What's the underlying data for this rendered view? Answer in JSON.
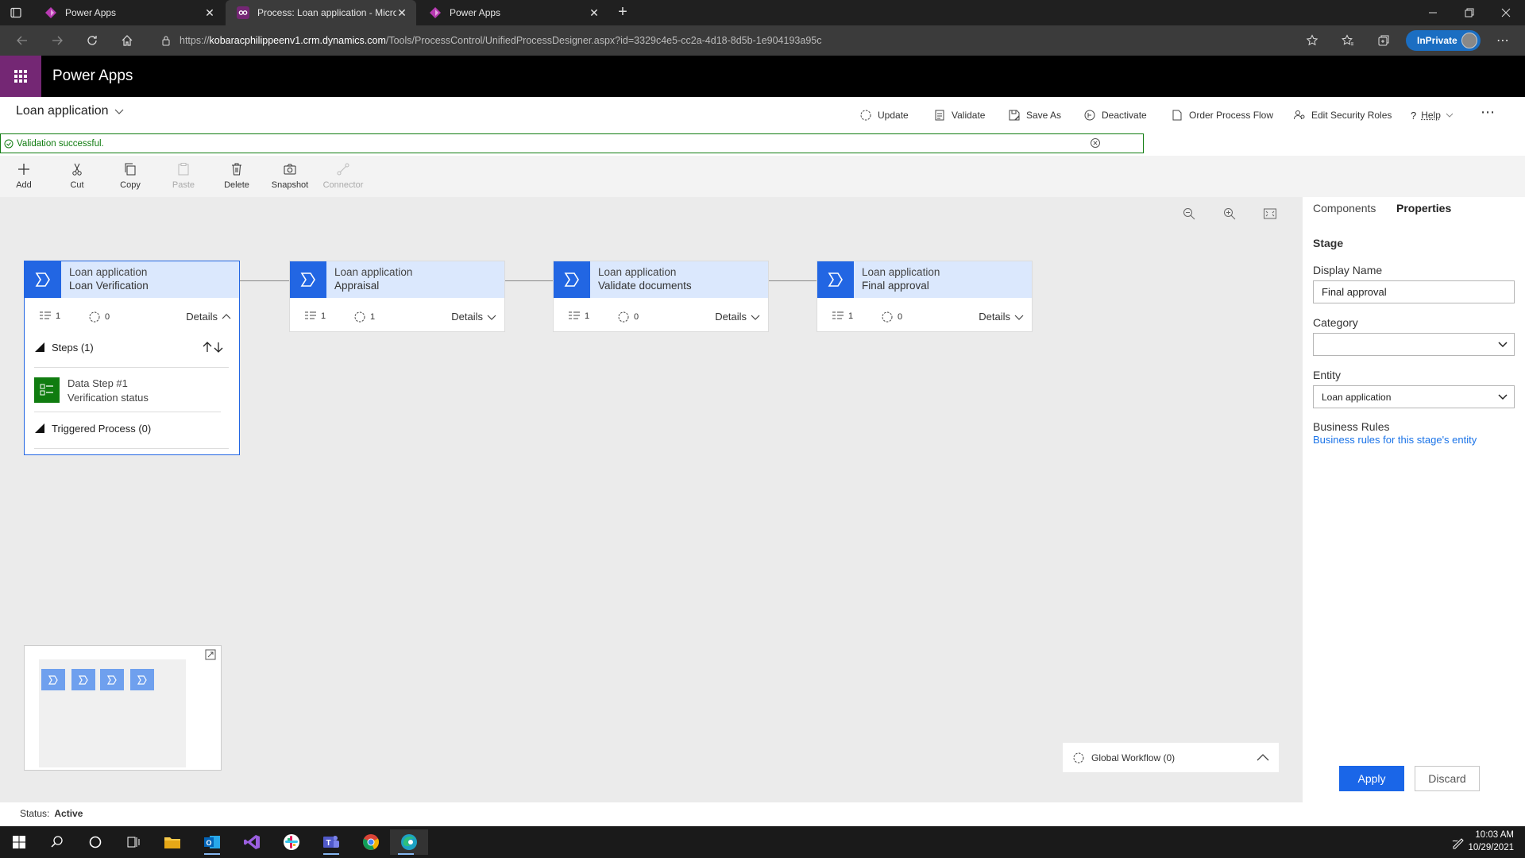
{
  "browser": {
    "tabs": [
      {
        "title": "Power Apps",
        "icon": "powerapps-icon",
        "active": false
      },
      {
        "title": "Process: Loan application - Micro",
        "icon": "dynamics-icon",
        "active": true
      },
      {
        "title": "Power Apps",
        "icon": "powerapps-icon",
        "active": false
      }
    ],
    "url_prefix": "https://",
    "url_host": "kobaracphilippeenv1.crm.dynamics.com",
    "url_path": "/Tools/ProcessControl/UnifiedProcessDesigner.aspx?id=3329c4e5-cc2a-4d18-8d5b-1e904193a95c",
    "inprivate": "InPrivate"
  },
  "app": {
    "title": "Power Apps",
    "accent": "#742774"
  },
  "process": {
    "title": "Loan application"
  },
  "commands": [
    "Update",
    "Validate",
    "Save As",
    "Deactivate",
    "Order Process Flow",
    "Edit Security Roles",
    "Help"
  ],
  "validation": {
    "message": "Validation successful."
  },
  "toolbar": [
    "Add",
    "Cut",
    "Copy",
    "Paste",
    "Delete",
    "Snapshot",
    "Connector"
  ],
  "stages": [
    {
      "entity": "Loan application",
      "name": "Loan Verification",
      "steps": "1",
      "workflows": "0",
      "details": "Details"
    },
    {
      "entity": "Loan application",
      "name": "Appraisal",
      "steps": "1",
      "workflows": "1",
      "details": "Details"
    },
    {
      "entity": "Loan application",
      "name": "Validate documents",
      "steps": "1",
      "workflows": "0",
      "details": "Details"
    },
    {
      "entity": "Loan application",
      "name": "Final approval",
      "steps": "1",
      "workflows": "0",
      "details": "Details"
    }
  ],
  "expanded_stage": {
    "steps_header": "Steps (1)",
    "step_title": "Data Step #1",
    "step_subtitle": "Verification status",
    "triggered": "Triggered Process (0)"
  },
  "global_workflow": "Global Workflow (0)",
  "status": {
    "label": "Status:",
    "value": "Active"
  },
  "panel": {
    "tabs": [
      "Components",
      "Properties"
    ],
    "section": "Stage",
    "display_name_label": "Display Name",
    "display_name": "Final approval",
    "category_label": "Category",
    "category": "",
    "entity_label": "Entity",
    "entity": "Loan application",
    "business_rules_label": "Business Rules",
    "business_rules_link": "Business rules for this stage's entity",
    "apply": "Apply",
    "discard": "Discard"
  },
  "clock": {
    "time": "10:03 AM",
    "date": "10/29/2021"
  },
  "colors": {
    "primary": "#2266e3",
    "success": "#107c10",
    "stage_header": "#dbe8fd"
  }
}
